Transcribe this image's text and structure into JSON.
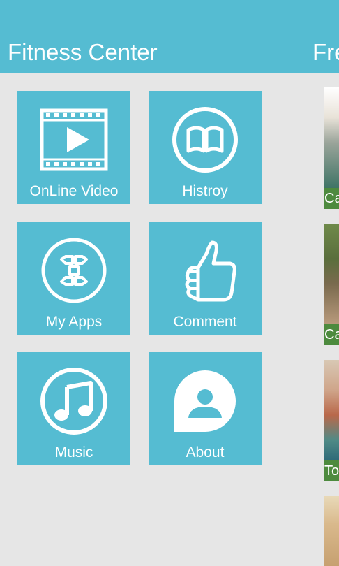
{
  "header": {
    "title": "Fitness Center",
    "next_section_title": "Fre"
  },
  "tiles": [
    {
      "label": "OnLine Video",
      "icon": "video-play-icon"
    },
    {
      "label": "Histroy",
      "icon": "book-icon"
    },
    {
      "label": "My Apps",
      "icon": "apps-icon"
    },
    {
      "label": "Comment",
      "icon": "thumbs-up-icon"
    },
    {
      "label": "Music",
      "icon": "music-note-icon"
    },
    {
      "label": "About",
      "icon": "person-chat-icon"
    }
  ],
  "side_cards": [
    {
      "caption": "Ca"
    },
    {
      "caption": "Ca"
    },
    {
      "caption": "To"
    },
    {
      "caption": ""
    }
  ],
  "colors": {
    "accent": "#55bcd2",
    "background": "#e6e6e6",
    "caption_bar": "#4d8a3e"
  }
}
